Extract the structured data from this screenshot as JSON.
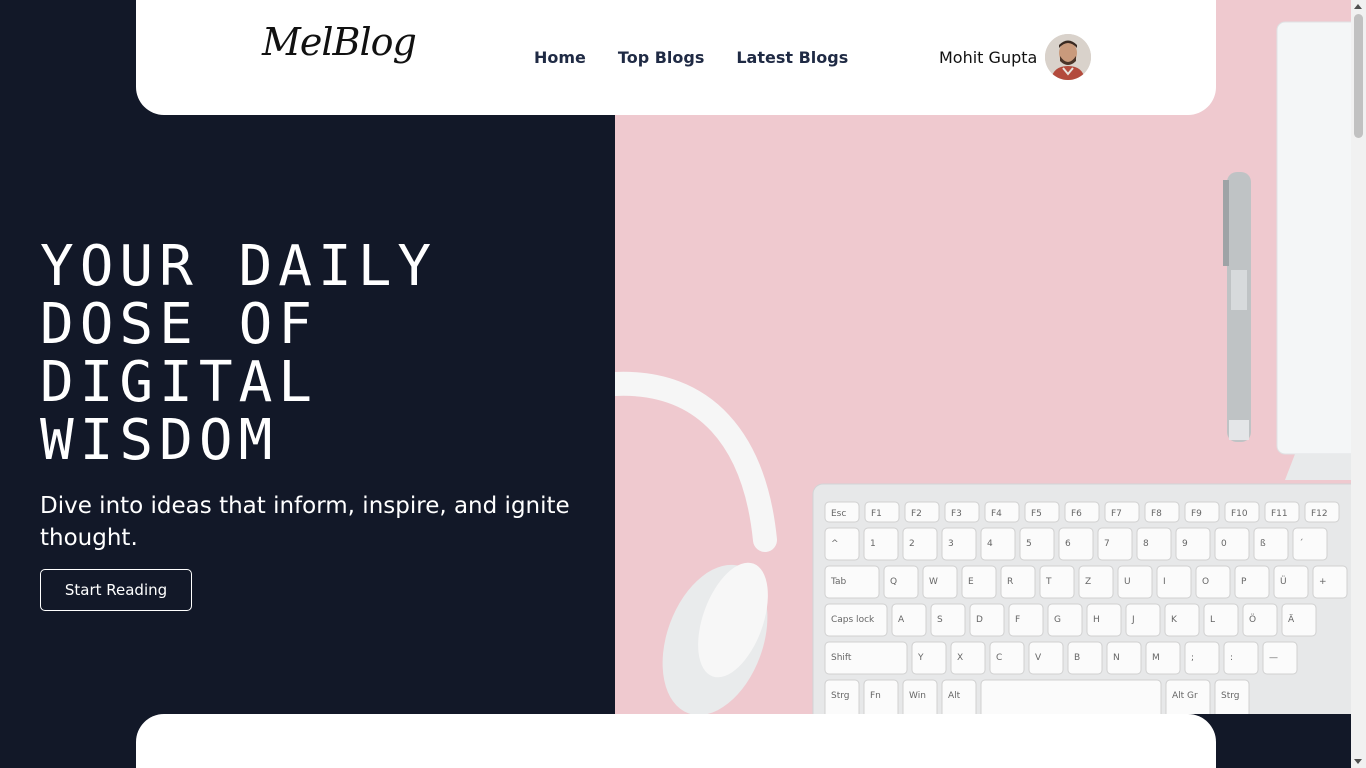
{
  "brand": {
    "logo": "MelBlog"
  },
  "nav": {
    "links": [
      "Home",
      "Top Blogs",
      "Latest Blogs"
    ],
    "user_name": "Mohit Gupta"
  },
  "hero": {
    "title_lines": [
      "YOUR DAILY",
      "DOSE OF",
      "DIGITAL",
      "WISDOM"
    ],
    "subtitle": "Dive into ideas that inform, inspire, and ignite thought.",
    "cta_label": "Start Reading"
  },
  "keyboard": {
    "row1": [
      "Esc",
      "F1",
      "F2",
      "F3",
      "F4",
      "F5",
      "F6",
      "F7",
      "F8",
      "F9",
      "F10",
      "F11",
      "F12"
    ],
    "row2": [
      "^",
      "1",
      "2",
      "3",
      "4",
      "5",
      "6",
      "7",
      "8",
      "9",
      "0",
      "ß",
      "´"
    ],
    "row3": [
      "Tab",
      "Q",
      "W",
      "E",
      "R",
      "T",
      "Z",
      "U",
      "I",
      "O",
      "P",
      "Ü",
      "+"
    ],
    "row4": [
      "Caps lock",
      "A",
      "S",
      "D",
      "F",
      "G",
      "H",
      "J",
      "K",
      "L",
      "Ö",
      "Ä"
    ],
    "row5": [
      "Shift",
      "Y",
      "X",
      "C",
      "V",
      "B",
      "N",
      "M",
      ";",
      ":",
      "—"
    ],
    "row6": [
      "Strg",
      "Fn",
      "Win",
      "Alt",
      "",
      "Alt Gr",
      "Strg"
    ]
  },
  "colors": {
    "dark_bg": "#121828",
    "pink_bg": "#efc9cf",
    "card_bg": "#ffffff"
  }
}
